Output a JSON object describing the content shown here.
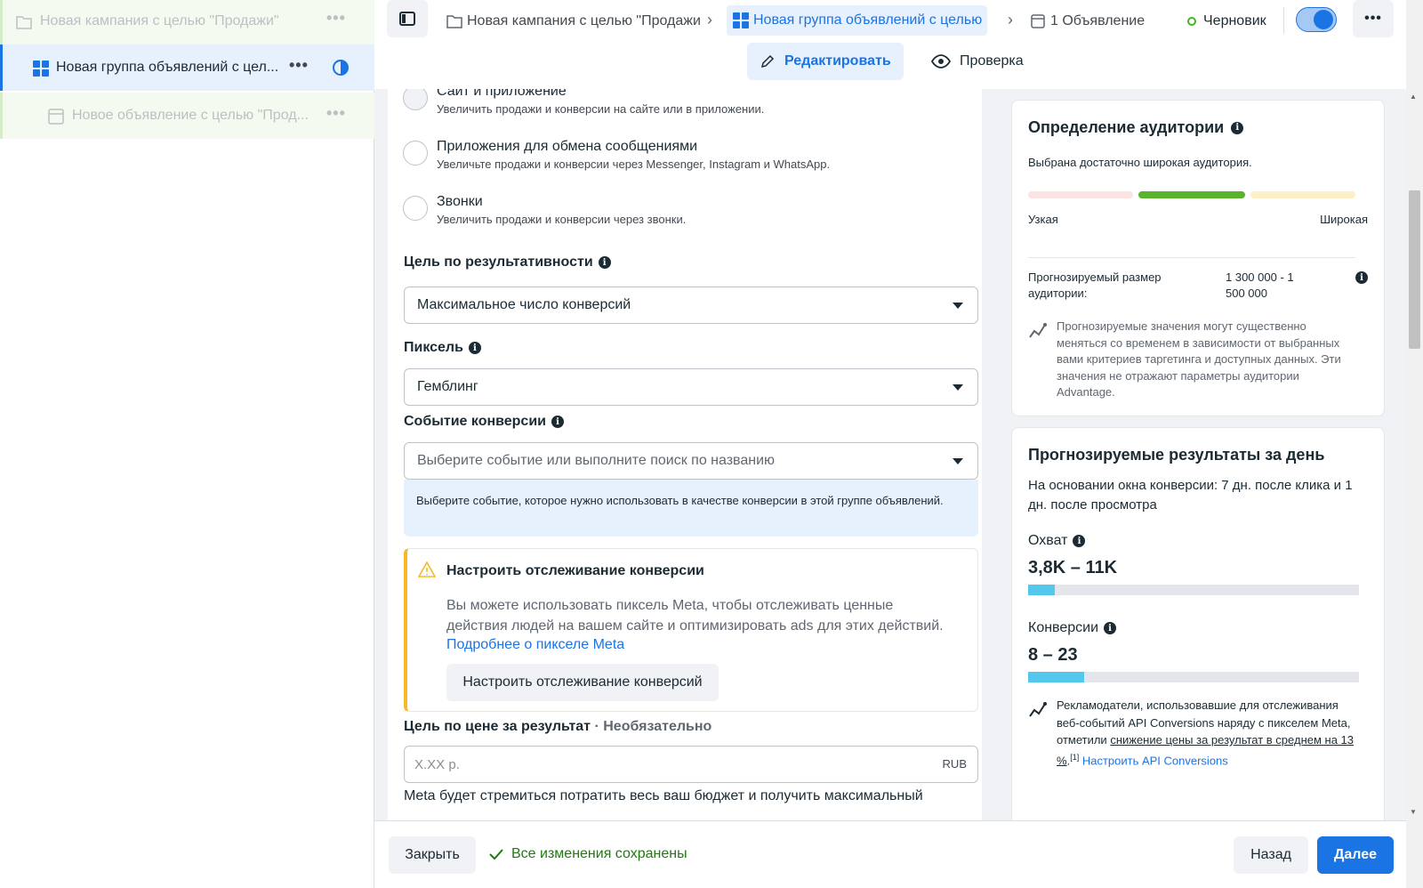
{
  "tree": {
    "campaign": "Новая кампания с целью \"Продажи\"",
    "adset": "Новая группа объявлений с цел...",
    "ad": "Новое объявление с целью \"Прод..."
  },
  "header": {
    "crumb_campaign": "Новая кампания с целью \"Продажи",
    "crumb_adset": "Новая группа объявлений с целью",
    "crumb_ad": "1 Объявление",
    "status": "Черновик",
    "edit_tab": "Редактировать",
    "review_tab": "Проверка"
  },
  "form": {
    "options": [
      {
        "title": "Сайт и приложение",
        "desc": "Увеличить продажи и конверсии на сайте или в приложении."
      },
      {
        "title": "Приложения для обмена сообщениями",
        "desc": "Увеличьте продажи и конверсии через Messenger, Instagram и WhatsApp."
      },
      {
        "title": "Звонки",
        "desc": "Увеличить продажи и конверсии через звонки."
      }
    ],
    "goal_label": "Цель по результативности",
    "goal_value": "Максимальное число конверсий",
    "pixel_label": "Пиксель",
    "pixel_value": "Гемблинг",
    "event_label": "Событие конверсии",
    "event_placeholder": "Выберите событие или выполните поиск по названию",
    "event_hint": "Выберите событие, которое нужно использовать в качестве конверсии в этой группе объявлений.",
    "warn_title": "Настроить отслеживание конверсии",
    "warn_text": "Вы можете использовать пиксель Meta, чтобы отслеживать ценные действия людей на вашем сайте и оптимизировать ads для этих действий.",
    "warn_link": "Подробнее о пикселе Meta",
    "warn_button": "Настроить отслеживание конверсий",
    "cost_label": "Цель по цене за результат",
    "cost_optional": "· Необязательно",
    "cost_placeholder": "X.XX р.",
    "cost_currency": "RUB",
    "cost_note": "Meta будет стремиться потратить весь ваш бюджет и получить максимальный"
  },
  "audience": {
    "title": "Определение аудитории",
    "subtitle": "Выбрана достаточно широкая аудитория.",
    "narrow": "Узкая",
    "wide": "Широкая",
    "size_label": "Прогнозируемый размер аудитории:",
    "size_value": "1 300 000 - 1 500 000",
    "note": "Прогнозируемые значения могут существенно меняться со временем в зависимости от выбранных вами критериев таргетинга и доступных данных. Эти значения не отражают параметры аудитории Advantage."
  },
  "results": {
    "title": "Прогнозируемые результаты за день",
    "subtitle": "На основании окна конверсии: 7 дн. после клика и 1 дн. после просмотра",
    "reach_label": "Охват",
    "reach_value": "3,8K – 11K",
    "reach_fill": 0.08,
    "conv_label": "Конверсии",
    "conv_value": "8 – 23",
    "conv_fill": 0.17,
    "note_pre": "Рекламодатели, использовавшие для отслеживания веб-событий API Conversions наряду с пикселем Meta, отметили ",
    "note_link": "снижение цены за результат в среднем на 13 %",
    "note_sup": "[1]",
    "note_cta": "Настроить API Conversions"
  },
  "footer": {
    "close": "Закрыть",
    "saved": "Все изменения сохранены",
    "back": "Назад",
    "next": "Далее"
  },
  "colors": {
    "accent": "#1b74e4",
    "success": "#42b72a",
    "warning": "#f7b928"
  }
}
